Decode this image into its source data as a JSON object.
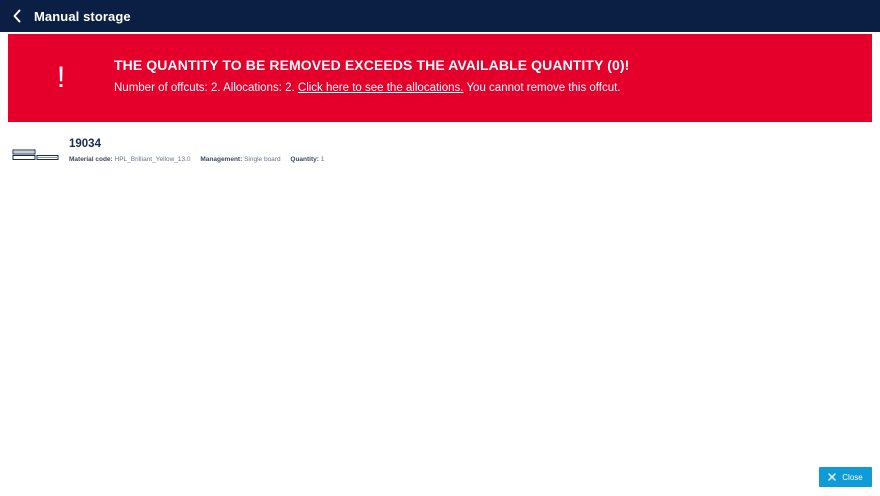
{
  "header": {
    "title": "Manual storage"
  },
  "alert": {
    "icon_symbol": "!",
    "title": "THE QUANTITY TO BE REMOVED EXCEEDS THE AVAILABLE QUANTITY (0)!",
    "message_before": "Number of offcuts: 2. Allocations: 2. ",
    "link_text": "Click here to see the allocations.",
    "message_after": " You cannot remove this offcut."
  },
  "item": {
    "icon": "board-stack-icon",
    "id": "19034",
    "material_code_label": "Material code:",
    "material_code_value": "HPL_Brilliant_Yellow_13.0",
    "management_label": "Management:",
    "management_value": "Single board",
    "quantity_label": "Quantity:",
    "quantity_value": "1"
  },
  "footer": {
    "close_label": "Close"
  },
  "colors": {
    "header_bg": "#0b1f45",
    "alert_bg": "#e4002b",
    "close_button_bg": "#0e9bd8"
  }
}
